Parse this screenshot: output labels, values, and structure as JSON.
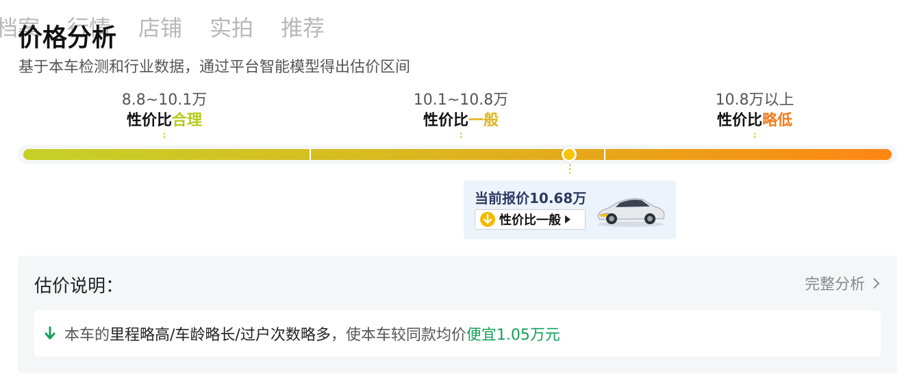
{
  "tabs": [
    "档案",
    "行情",
    "店铺",
    "实拍",
    "推荐"
  ],
  "title": "价格分析",
  "subtitle": "基于本车检测和行业数据，通过平台智能模型得出估价区间",
  "ranges": [
    {
      "price": "8.8~10.1万",
      "prefix": "性价比",
      "level": "合理"
    },
    {
      "price": "10.1~10.8万",
      "prefix": "性价比",
      "level": "一般"
    },
    {
      "price": "10.8万以上",
      "prefix": "性价比",
      "level": "略低"
    }
  ],
  "colors": {
    "green": "#b6c91a",
    "yellow": "#e0b41c",
    "orange": "#f47a1a",
    "marker": "#f7c400",
    "cheaper": "#14a05a"
  },
  "current": {
    "price_text": "当前报价10.68万",
    "badge": "性价比一般",
    "badge_icon": "down-arrow-icon",
    "image": "white-sedan-car"
  },
  "explanation": {
    "title": "估价说明：",
    "link": "完整分析",
    "prefix": "本车的",
    "factors": "里程略高/车龄略长/过户次数略多",
    "middle": "，使本车较同款均价",
    "result": "便宜1.05万元"
  }
}
